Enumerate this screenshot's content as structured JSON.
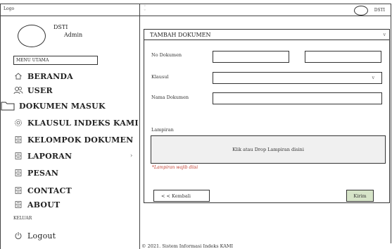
{
  "topbar": {
    "logo": "Logo",
    "user_short": "DSTI"
  },
  "sidebar": {
    "profile_name": "DSTI",
    "profile_role": "Admin",
    "menu_header": "MENU UTAMA",
    "items": [
      {
        "label": "BERANDA",
        "icon": "home-icon",
        "has_chevron": false
      },
      {
        "label": "USER",
        "icon": "users-icon",
        "has_chevron": false
      },
      {
        "label": "DOKUMEN MASUK",
        "icon": "folder-icon",
        "has_chevron": false
      },
      {
        "label": "KLAUSUL INDEKS KAMI",
        "icon": "gear-icon",
        "has_chevron": true
      },
      {
        "label": "KELOMPOK DOKUMEN",
        "icon": "document-icon",
        "has_chevron": true
      },
      {
        "label": "LAPORAN",
        "icon": "document-icon",
        "has_chevron": true
      },
      {
        "label": "PESAN",
        "icon": "document-icon",
        "has_chevron": false
      },
      {
        "label": "CONTACT",
        "icon": "document-icon",
        "has_chevron": false
      },
      {
        "label": "ABOUT",
        "icon": "document-icon",
        "has_chevron": false
      }
    ],
    "section_keluar": "KELUAR",
    "logout_label": "Logout",
    "chevron": "›"
  },
  "form": {
    "title": "TAMBAH DOKUMEN",
    "no_dokumen_label": "No Dokumen",
    "no_dokumen_value": "",
    "no_dokumen_extra_value": "",
    "klausul_label": "Klausul",
    "klausul_value": "",
    "nama_dokumen_label": "Nama Dokumen",
    "nama_dokumen_value": "",
    "lampiran_label": "Lampiran",
    "dropzone_text": "Klik atau Drop Lampiran disini",
    "required_note": "*Lampiran wajib diisi",
    "back_label": "< <  Kembali",
    "submit_label": "Kirim",
    "caret": "v"
  },
  "footer": {
    "text": "© 2021. Sistem Informasi Indeks KAMI"
  },
  "colors": {
    "submit_bg": "#d6e4c8",
    "required_text": "#c0392b",
    "dropzone_bg": "#f0f0f0"
  }
}
